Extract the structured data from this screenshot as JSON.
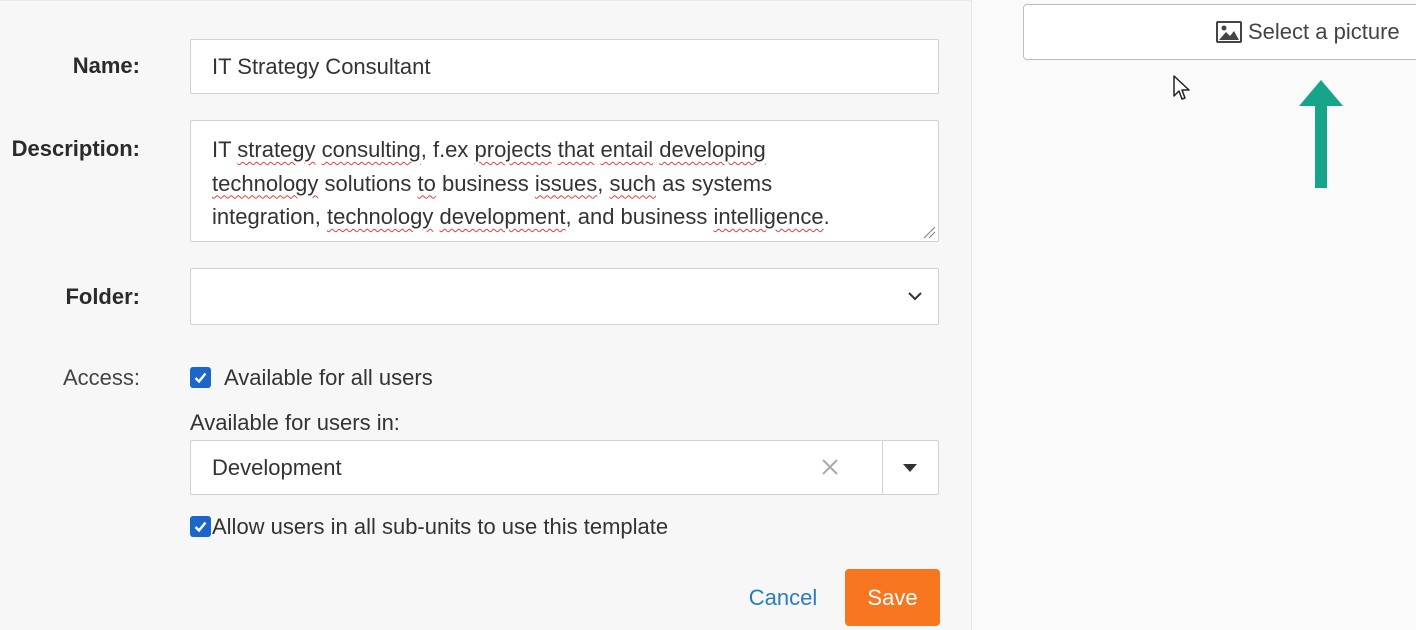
{
  "form": {
    "name_label": "Name:",
    "name_value": "IT Strategy Consultant",
    "description_label": "Description:",
    "description_lines": [
      [
        {
          "t": "IT ",
          "s": false
        },
        {
          "t": "strategy",
          "s": true
        },
        {
          "t": " ",
          "s": false
        },
        {
          "t": "consulting",
          "s": true
        },
        {
          "t": ", f.ex ",
          "s": false
        },
        {
          "t": "projects",
          "s": true
        },
        {
          "t": " ",
          "s": false
        },
        {
          "t": "that",
          "s": true
        },
        {
          "t": " ",
          "s": false
        },
        {
          "t": "entail",
          "s": true
        },
        {
          "t": " ",
          "s": false
        },
        {
          "t": "developing",
          "s": true
        }
      ],
      [
        {
          "t": "technology",
          "s": true
        },
        {
          "t": " solutions ",
          "s": false
        },
        {
          "t": "to",
          "s": true
        },
        {
          "t": " business ",
          "s": false
        },
        {
          "t": "issues",
          "s": true
        },
        {
          "t": ", ",
          "s": false
        },
        {
          "t": "such",
          "s": true
        },
        {
          "t": " as systems",
          "s": false
        }
      ],
      [
        {
          "t": "integration, ",
          "s": false
        },
        {
          "t": "technology",
          "s": true
        },
        {
          "t": " ",
          "s": false
        },
        {
          "t": "development",
          "s": true
        },
        {
          "t": ", and business ",
          "s": false
        },
        {
          "t": "intelligence",
          "s": true
        },
        {
          "t": ".",
          "s": false
        }
      ]
    ],
    "folder_label": "Folder:",
    "folder_value": "",
    "access_label": "Access:",
    "available_all_label": "Available for all users",
    "available_all_checked": true,
    "available_in_label": "Available for users in:",
    "unit_value": "Development",
    "allow_subunits_label": "Allow users in all sub-units to use this template",
    "allow_subunits_checked": true,
    "cancel_label": "Cancel",
    "save_label": "Save"
  },
  "picture": {
    "label": "Select a picture",
    "icon": "image-icon"
  },
  "colors": {
    "accent_blue": "#1a66c9",
    "save_orange": "#f7761f",
    "link_blue": "#2a7bbf",
    "arrow_teal": "#16a58a",
    "spell_red": "#e0413a"
  }
}
